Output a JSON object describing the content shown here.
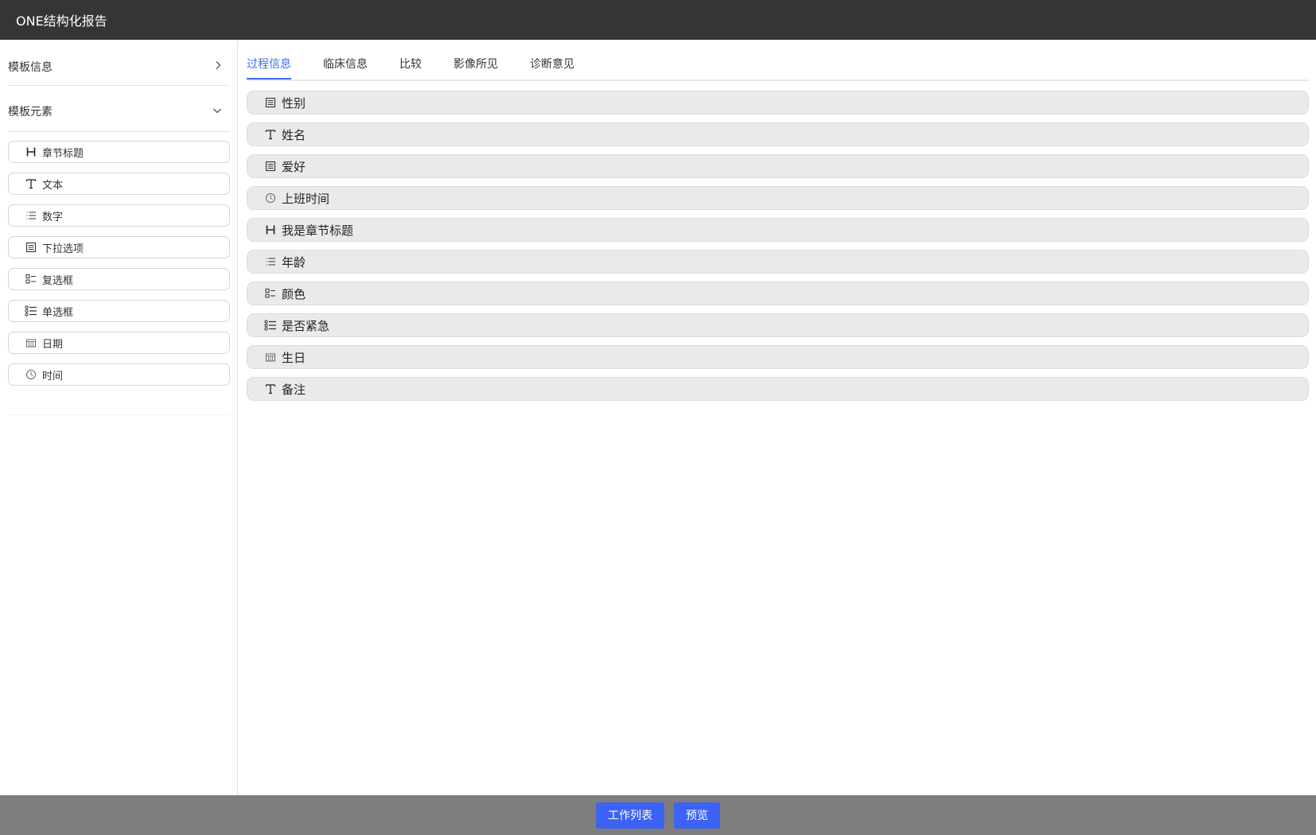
{
  "app": {
    "title": "ONE结构化报告"
  },
  "sidebar": {
    "template_info": {
      "label": "模板信息",
      "chevron": "chevron-right-icon"
    },
    "template_elements": {
      "label": "模板元素",
      "chevron": "chevron-down-icon"
    },
    "elements": [
      {
        "label": "章节标题",
        "icon": "heading-icon"
      },
      {
        "label": "文本",
        "icon": "text-icon"
      },
      {
        "label": "数字",
        "icon": "number-list-icon"
      },
      {
        "label": "下拉选项",
        "icon": "dropdown-icon"
      },
      {
        "label": "复选框",
        "icon": "checkbox-icon"
      },
      {
        "label": "单选框",
        "icon": "radio-list-icon"
      },
      {
        "label": "日期",
        "icon": "calendar-icon"
      },
      {
        "label": "时间",
        "icon": "clock-icon"
      }
    ]
  },
  "main": {
    "tabs": [
      {
        "label": "过程信息",
        "active": true
      },
      {
        "label": "临床信息",
        "active": false
      },
      {
        "label": "比较",
        "active": false
      },
      {
        "label": "影像所见",
        "active": false
      },
      {
        "label": "诊断意见",
        "active": false
      }
    ],
    "fields": [
      {
        "label": "性别",
        "icon": "dropdown-icon"
      },
      {
        "label": "姓名",
        "icon": "text-icon"
      },
      {
        "label": "爱好",
        "icon": "dropdown-icon"
      },
      {
        "label": "上班时间",
        "icon": "clock-icon"
      },
      {
        "label": "我是章节标题",
        "icon": "heading-icon"
      },
      {
        "label": "年龄",
        "icon": "number-list-icon"
      },
      {
        "label": "颜色",
        "icon": "checkbox-icon"
      },
      {
        "label": "是否紧急",
        "icon": "radio-list-icon"
      },
      {
        "label": "生日",
        "icon": "calendar-icon"
      },
      {
        "label": "备注",
        "icon": "text-icon"
      }
    ]
  },
  "footer": {
    "worklist_label": "工作列表",
    "preview_label": "预览"
  },
  "colors": {
    "topbar": "#353535",
    "accent": "#3d6cf0",
    "button": "#3d63f5",
    "footer": "#7d7d7d",
    "field_bg": "#eaeaea"
  }
}
